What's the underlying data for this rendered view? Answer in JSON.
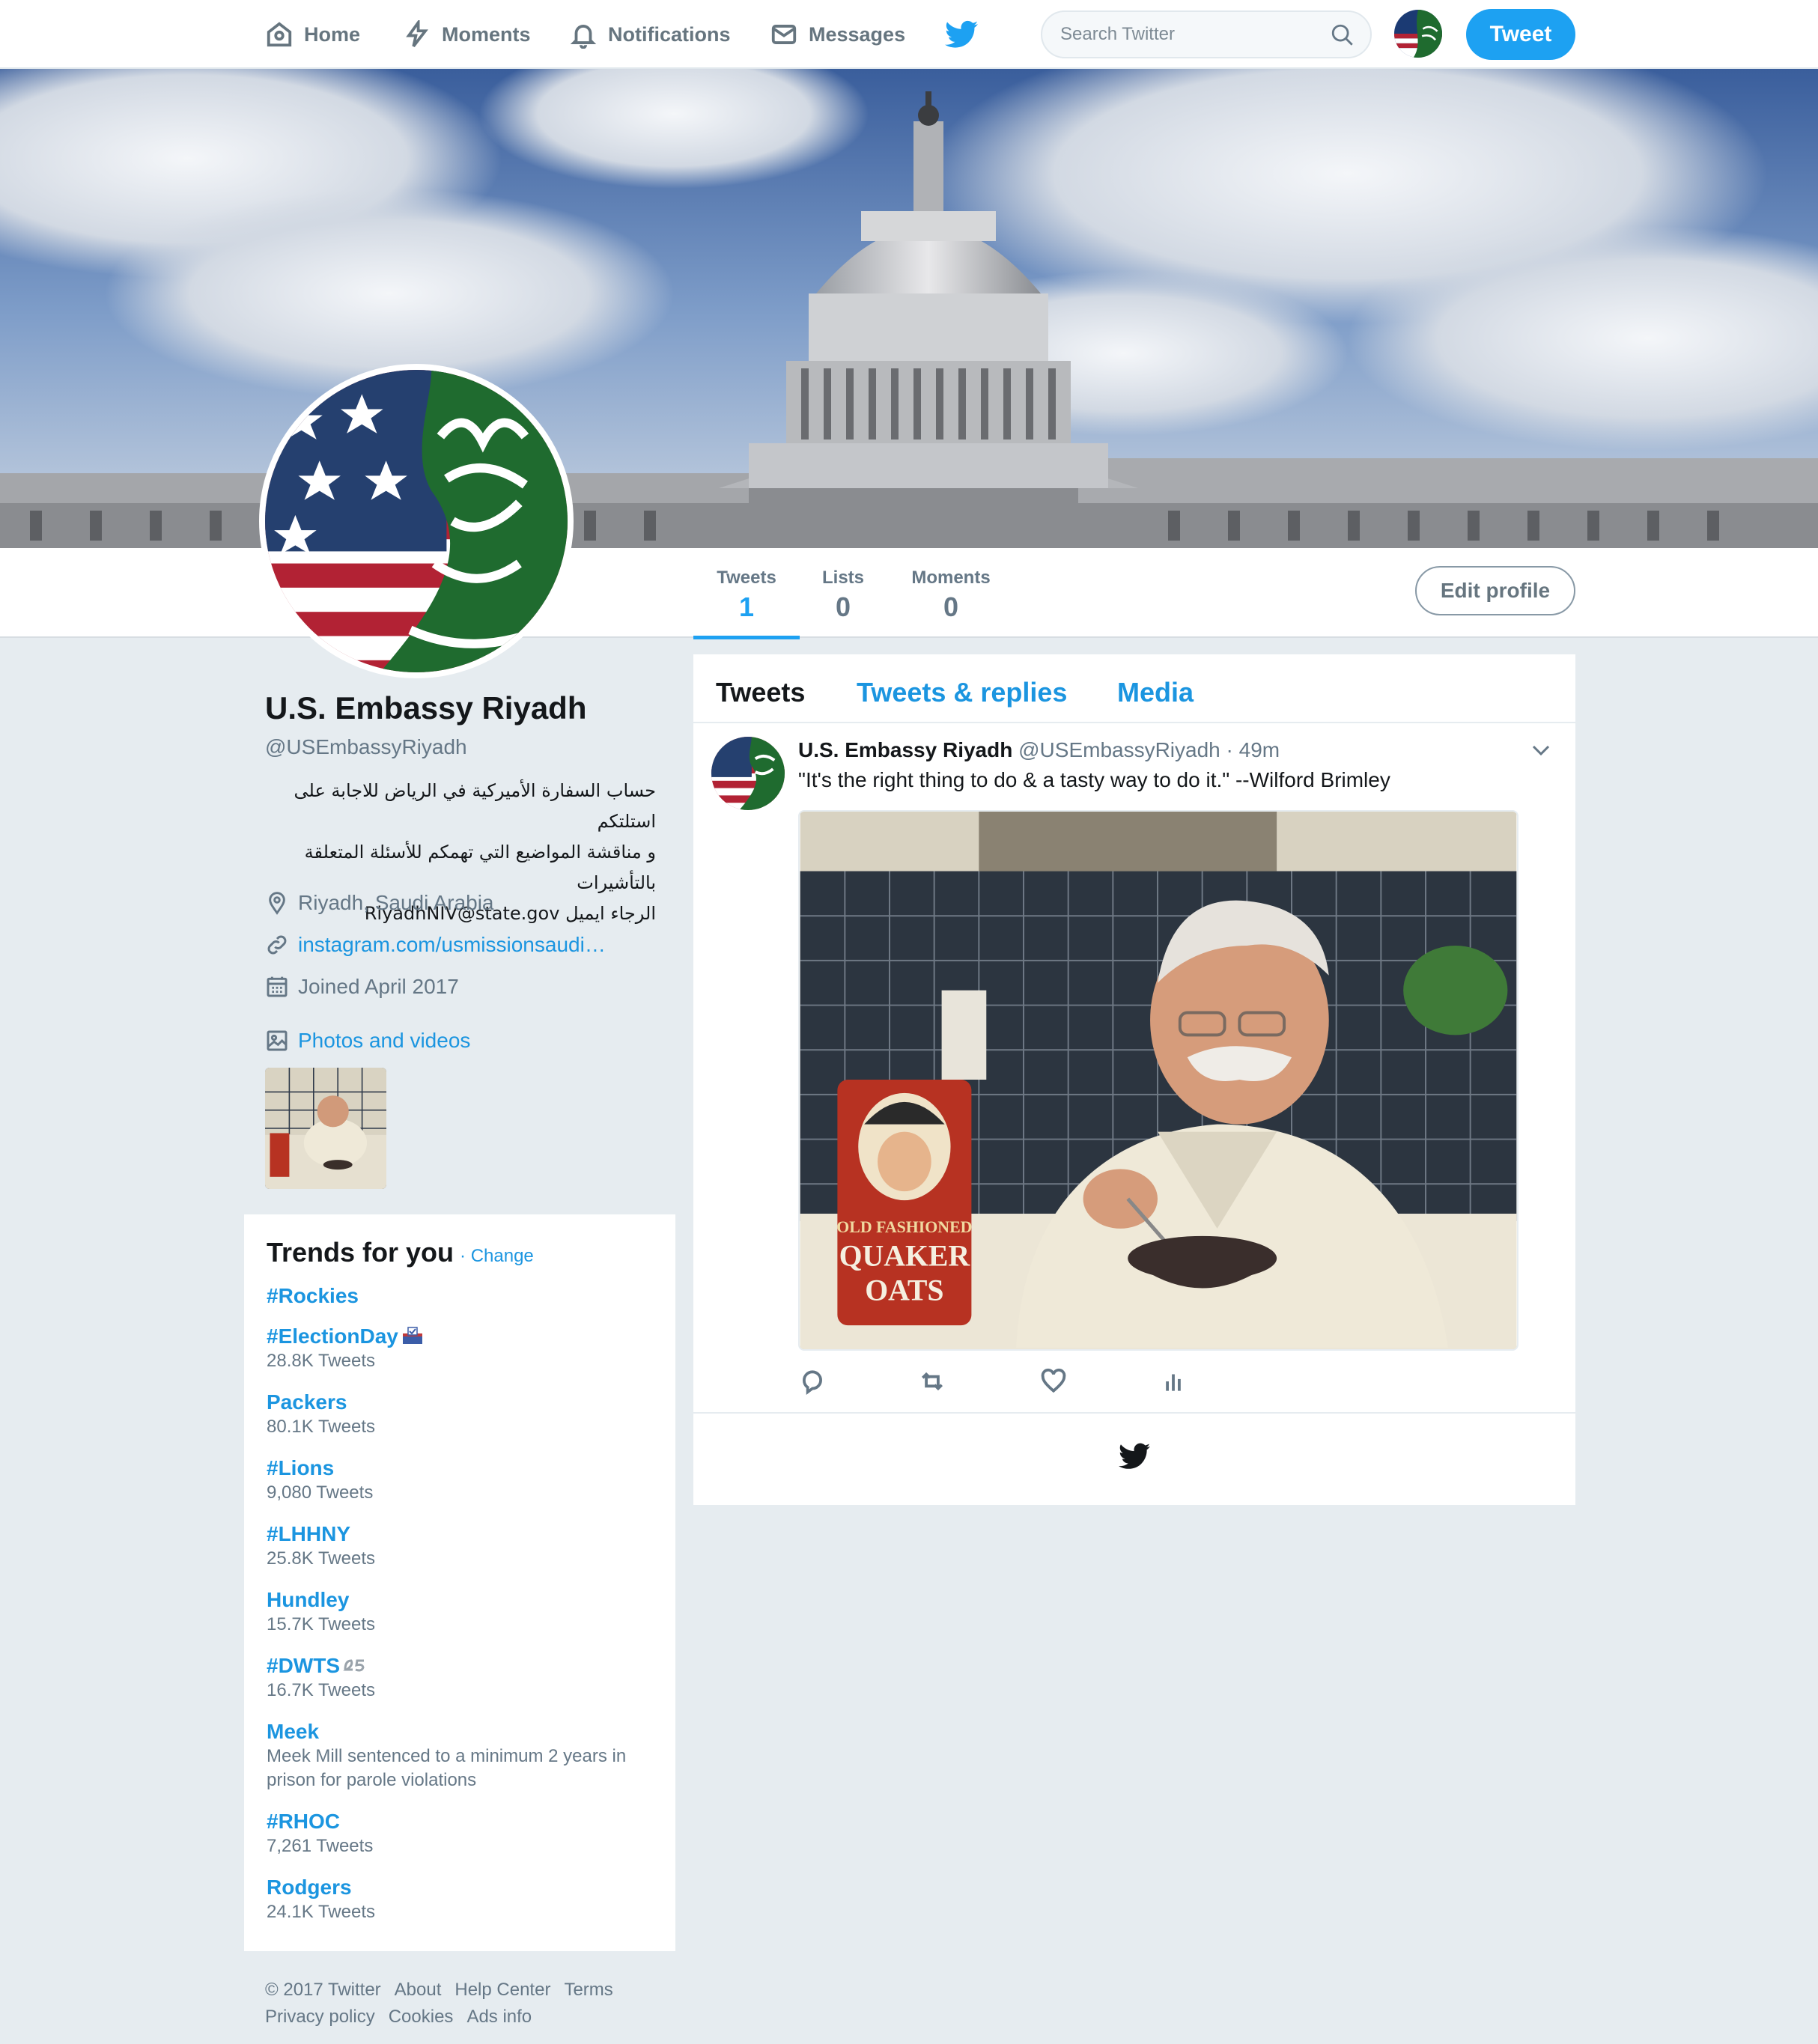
{
  "nav": {
    "home": "Home",
    "moments": "Moments",
    "notifications": "Notifications",
    "messages": "Messages",
    "search_placeholder": "Search Twitter",
    "tweet_button": "Tweet",
    "icons": [
      "home-icon",
      "moments-icon",
      "notifications-icon",
      "messages-icon",
      "twitter-bird-icon",
      "search-icon"
    ]
  },
  "profile_nav": {
    "stats": [
      {
        "label": "Tweets",
        "value": "1"
      },
      {
        "label": "Lists",
        "value": "0"
      },
      {
        "label": "Moments",
        "value": "0"
      }
    ],
    "edit_profile": "Edit profile"
  },
  "profile": {
    "name": "U.S. Embassy Riyadh",
    "handle": "@USEmbassyRiyadh",
    "bio_lines": [
      "حساب السفارة الأميركية في الرياض للاجابة على استلتكم",
      "و مناقشة المواضيع التي تهمكم للأسئلة المتعلقة بالتأشيرات",
      "الرجاء ايميل RiyadhNIV@state.gov"
    ],
    "location": "Riyadh, Saudi Arabia",
    "website": "instagram.com/usmissionsaudi…",
    "joined": "Joined April 2017",
    "photos_link": "Photos and videos"
  },
  "trends": {
    "title": "Trends for you",
    "change": "· Change",
    "items": [
      {
        "name": "#Rockies",
        "count": ""
      },
      {
        "name": "#ElectionDay",
        "count": "28.8K Tweets"
      },
      {
        "name": "Packers",
        "count": "80.1K Tweets"
      },
      {
        "name": "#Lions",
        "count": "9,080 Tweets"
      },
      {
        "name": "#LHHNY",
        "count": "25.8K Tweets"
      },
      {
        "name": "Hundley",
        "count": "15.7K Tweets"
      },
      {
        "name": "#DWTS",
        "count": "16.7K Tweets"
      },
      {
        "name": "Meek",
        "count": "Meek Mill sentenced to a minimum 2 years in prison for parole violations"
      },
      {
        "name": "#RHOC",
        "count": "7,261 Tweets"
      },
      {
        "name": "Rodgers",
        "count": "24.1K Tweets"
      }
    ]
  },
  "footer": {
    "line1": [
      "© 2017 Twitter",
      "About",
      "Help Center",
      "Terms"
    ],
    "line2": [
      "Privacy policy",
      "Cookies",
      "Ads info"
    ]
  },
  "timeline": {
    "tabs": [
      "Tweets",
      "Tweets & replies",
      "Media"
    ],
    "tweet": {
      "name": "U.S. Embassy Riyadh",
      "handle_time": "@USEmbassyRiyadh · 49m",
      "text": "\"It's the right thing to do & a tasty way to do it.\" --Wilford Brimley",
      "media_label": "OLD FASHIONED QUAKER OATS"
    }
  },
  "colors": {
    "accent": "#1da1f2",
    "link": "#1b95e0",
    "background": "#e6ecf0",
    "muted": "#657786"
  }
}
